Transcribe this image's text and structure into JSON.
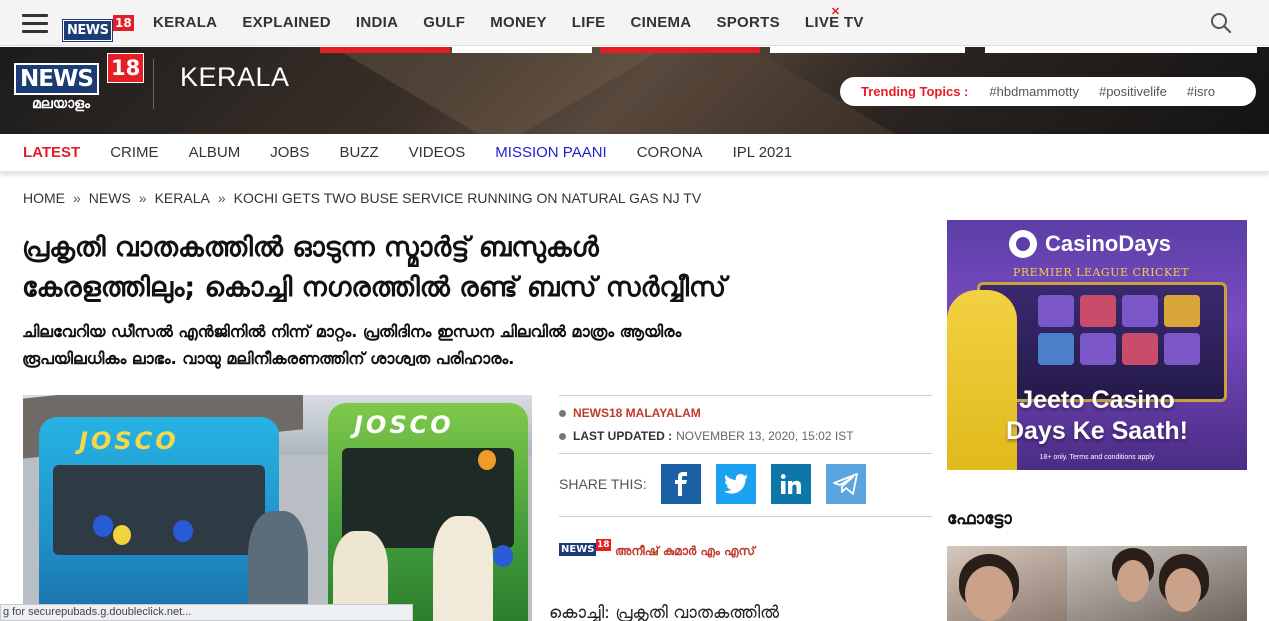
{
  "topnav": {
    "logo_text": "NEWS",
    "logo_number": "18",
    "links": [
      "KERALA",
      "EXPLAINED",
      "INDIA",
      "GULF",
      "MONEY",
      "LIFE",
      "CINEMA",
      "SPORTS",
      "LIVE TV"
    ]
  },
  "banner": {
    "logo_text": "NEWS",
    "logo_number": "18",
    "logo_sub": "മലയാളം",
    "section": "KERALA",
    "trending_label": "Trending Topics :",
    "trending": [
      "#hbdmammotty",
      "#positivelife",
      "#isro"
    ]
  },
  "subnav": {
    "items": [
      "LATEST",
      "CRIME",
      "ALBUM",
      "JOBS",
      "BUZZ",
      "VIDEOS",
      "MISSION PAANI",
      "CORONA",
      "IPL 2021"
    ]
  },
  "breadcrumb": [
    "HOME",
    "NEWS",
    "KERALA",
    "KOCHI GETS TWO BUSE SERVICE RUNNING ON NATURAL GAS NJ TV"
  ],
  "article": {
    "headline_line1": "പ്രകൃതി വാതകത്തിൽ ഓടുന്ന സ്മാർട്ട് ബസുകൾ",
    "headline_line2": "കേരളത്തിലും; കൊച്ചി നഗരത്തിൽ രണ്ട് ബസ് സർവ്വീസ്",
    "standfirst_line1": "ചിലവേറിയ ഡീസൽ എൻജിനിൽ നിന്ന് മാറ്റം. പ്രതിദിനം ഇന്ധന ചിലവിൽ മാത്രം ആയിരം",
    "standfirst_line2": "രൂപയിലധികം ലാഭം. വായു മലിനീകരണത്തിന് ശാശ്വത പരിഹാരം.",
    "bus1_sign": "JOSCO",
    "bus2_sign": "JOSCO",
    "source": "NEWS18 MALAYALAM",
    "updated_label": "LAST UPDATED :",
    "updated_value": "NOVEMBER 13, 2020, 15:02 IST",
    "share_label": "SHARE THIS:",
    "author_logo_text": "NEWS",
    "author_logo_number": "18",
    "author": "അനീഷ് കുമാർ എം എസ്",
    "body_start": "കൊച്ചി: പ്രകൃതി വാതകത്തിൽ"
  },
  "status_bar": "g for securepubads.g.doubleclick.net...",
  "ad": {
    "brand": "CasinoDays",
    "league": "PREMIER LEAGUE CRICKET",
    "tagline1": "Jeeto Casino",
    "tagline2": "Days Ke Saath!",
    "terms": "18+ only. Terms and conditions apply"
  },
  "sidebar": {
    "photo_heading": "ഫോട്ടോ"
  },
  "colors": {
    "accent_red": "#e51e25",
    "brand_blue": "#1a3b73",
    "facebook": "#1b5fa5",
    "twitter": "#1da1f2",
    "linkedin": "#0e76a8",
    "telegram": "#5aa5df"
  },
  "icons": {
    "menu": "hamburger-icon",
    "search": "search-icon",
    "share": [
      "facebook-icon",
      "twitter-icon",
      "linkedin-icon",
      "telegram-icon"
    ]
  }
}
